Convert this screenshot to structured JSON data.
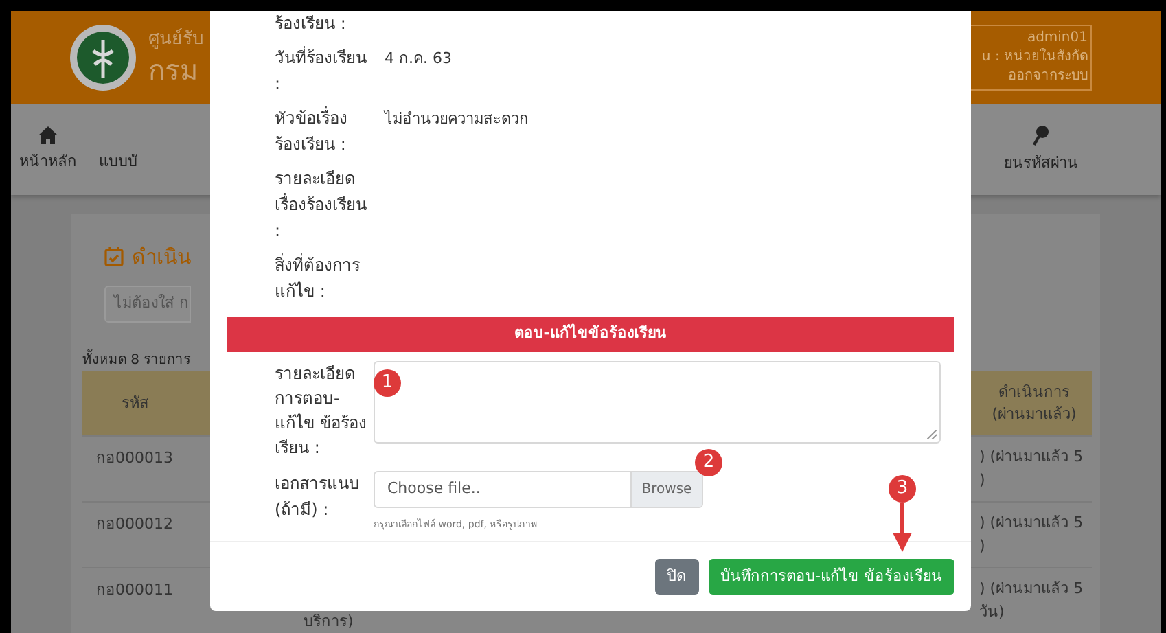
{
  "header": {
    "org_line_1": "ศูนย์รับ",
    "org_line_2": "กรม",
    "user": "admin01",
    "role": "u : หน่วยในสังกัด",
    "logout": "ออกจากระบบ"
  },
  "nav": [
    {
      "kind": "home",
      "label": "หน้าหลัก"
    },
    {
      "kind": "text",
      "label": "แบบบั"
    },
    {
      "kind": "key",
      "label": "ยนรหัสผ่าน"
    }
  ],
  "page": {
    "title": "ดำเนิน",
    "search_placeholder": "ไม่ต้องใส่ ก",
    "total": "ทั้งหมด 8 รายการ",
    "columns": [
      "รหัส",
      "ดำเนินการ (ผ่านมาแล้ว)"
    ],
    "rows": [
      {
        "code": "กอ000013",
        "status": ") (ผ่านมาแล้ว 5",
        "status_2": ")"
      },
      {
        "code": "กอ000012",
        "status": ") (ผ่านมาแล้ว 5",
        "status_2": ")"
      },
      {
        "code": "กอ000011",
        "middle": "บริการ)",
        "status": ") (ผ่านมาแล้ว 5",
        "status_2": "วัน)"
      }
    ]
  },
  "modal": {
    "fields": [
      {
        "label": "ร้องเรียน :"
      },
      {
        "label": "วันที่ร้องเรียน :",
        "value": "4 ก.ค. 63"
      },
      {
        "label": "หัวข้อเรื่อง ร้องเรียน :",
        "value": "ไม่อำนวยความสะดวก"
      },
      {
        "label": "รายละเอียด เรื่องร้องเรียน :"
      },
      {
        "label": "สิ่งที่ต้องการ แก้ไข :"
      }
    ],
    "section_title": "ตอบ-แก้ไขข้อร้องเรียน",
    "reply_label": "รายละเอียดการตอบ-แก้ไข ข้อร้องเรียน :",
    "attachment_label": "เอกสารแนบ (ถ้ามี) :",
    "file_placeholder": "Choose file..",
    "browse": "Browse",
    "hint": "กรุณาเลือกไฟล์ word, pdf, หรือรูปภาพ",
    "close_button": "ปิด",
    "save_button": "บันทึกการตอบ-แก้ไข ข้อร้องเรียน"
  },
  "annotations": [
    "1",
    "2",
    "3"
  ]
}
